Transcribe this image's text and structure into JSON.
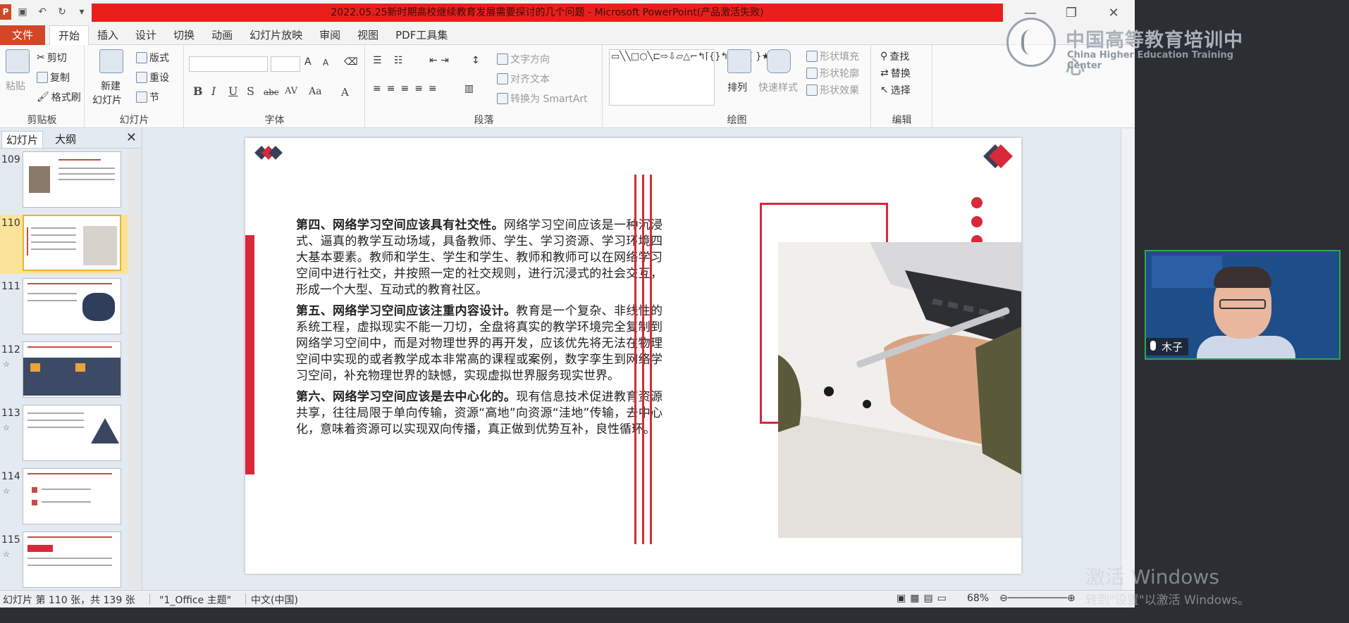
{
  "window": {
    "title": "2022.05.25新时期高校继续教育发展需要探讨的几个问题 - Microsoft PowerPoint(产品激活失败)",
    "app_logo": "P"
  },
  "menu": {
    "file": "文件",
    "tabs": [
      "开始",
      "插入",
      "设计",
      "切换",
      "动画",
      "幻灯片放映",
      "审阅",
      "视图",
      "PDF工具集"
    ]
  },
  "ribbon": {
    "clipboard": {
      "paste": "粘贴",
      "cut": "剪切",
      "copy": "复制",
      "format_painter": "格式刷",
      "label": "剪贴板"
    },
    "slides": {
      "new_slide_1": "新建",
      "new_slide_2": "幻灯片",
      "layout": "版式",
      "reset": "重设",
      "section": "节",
      "label": "幻灯片"
    },
    "font": {
      "label": "字体",
      "bold": "B",
      "italic": "I",
      "underline": "U",
      "shadow": "S",
      "strike": "abc",
      "spacing": "AV",
      "case": "Aa",
      "grow": "A",
      "shrink": "A"
    },
    "paragraph": {
      "text_direction": "文字方向",
      "align_text": "对齐文本",
      "smartart": "转换为 SmartArt",
      "label": "段落"
    },
    "drawing": {
      "arrange": "排列",
      "quick_styles": "快速样式",
      "shape_fill": "形状填充",
      "shape_outline": "形状轮廓",
      "shape_effects": "形状效果",
      "label": "绘图"
    },
    "editing": {
      "find": "查找",
      "replace": "替换",
      "select": "选择",
      "label": "编辑"
    }
  },
  "overlay_logo": {
    "cn": "中国高等教育培训中心",
    "en": "China Higher Education Training Center"
  },
  "left_pane": {
    "tab_slides": "幻灯片",
    "tab_outline": "大纲",
    "close": "✕",
    "thumbnails": [
      {
        "num": "109",
        "selected": false
      },
      {
        "num": "110",
        "selected": true
      },
      {
        "num": "111",
        "selected": false
      },
      {
        "num": "112",
        "selected": false
      },
      {
        "num": "113",
        "selected": false
      },
      {
        "num": "114",
        "selected": false
      },
      {
        "num": "115",
        "selected": false
      }
    ]
  },
  "slide": {
    "p1_bold": "第四、网络学习空间应该具有社交性。",
    "p1_text": "网络学习空间应该是一种沉浸式、逼真的教学互动场域，具备教师、学生、学习资源、学习环境四大基本要素。教师和学生、学生和学生、教师和教师可以在网络学习空间中进行社交，并按照一定的社交规则，进行沉浸式的社会交互，形成一个大型、互动式的教育社区。",
    "p2_bold": "第五、网络学习空间应该注重内容设计。",
    "p2_text": "教育是一个复杂、非线性的系统工程，虚拟现实不能一刀切，全盘将真实的教学环境完全复制到网络学习空间中，而是对物理世界的再开发，应该优先将无法在物理空间中实现的或者教学成本非常高的课程或案例，数字孪生到网络学习空间，补充物理世界的缺憾，实现虚拟世界服务现实世界。",
    "p3_bold": "第六、网络学习空间应该是去中心化的。",
    "p3_text": "现有信息技术促进教育资源共享，往往局限于单向传输，资源“高地”向资源“洼地”传输，去中心化，意味着资源可以实现双向传播，真正做到优势互补，良性循环。"
  },
  "statusbar": {
    "slide_info": "幻灯片 第 110 张，共 139 张",
    "theme": "\"1_Office 主题\"",
    "language": "中文(中国)",
    "zoom": "68%"
  },
  "video": {
    "name": "木子"
  },
  "watermark": {
    "line1": "激活 Windows",
    "line2": "转到\"设置\"以激活 Windows。"
  },
  "colors": {
    "accent_red": "#d8283a",
    "title_red": "#e8201b",
    "file_tab": "#d24726",
    "video_border": "#2ea84a"
  }
}
